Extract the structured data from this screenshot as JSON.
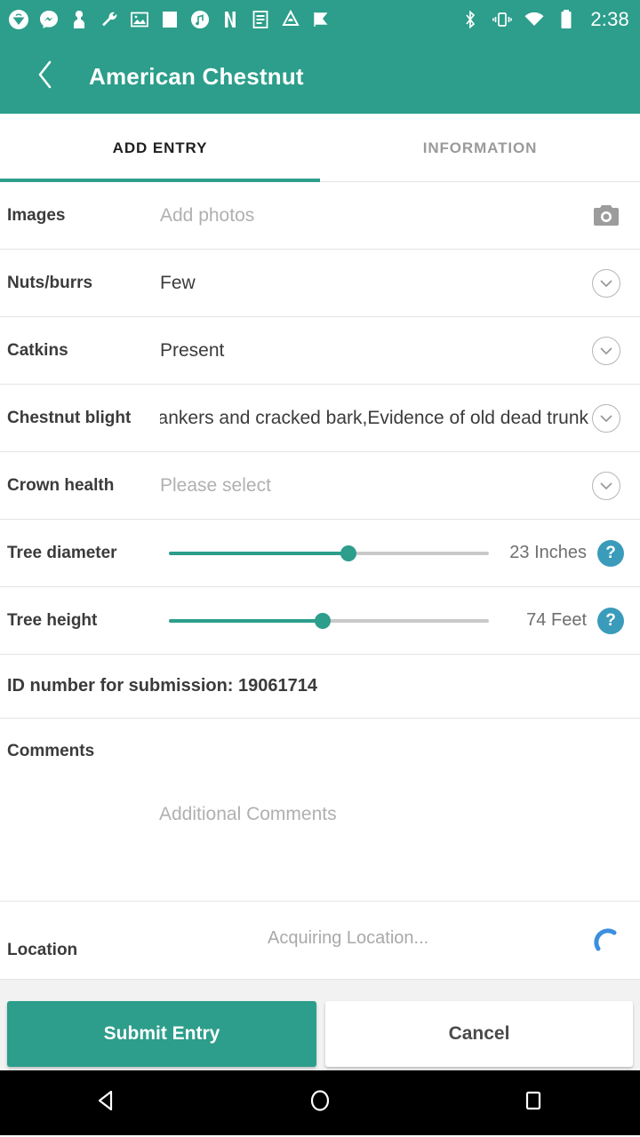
{
  "status_bar": {
    "time": "2:38",
    "left_icons": [
      {
        "name": "app-notification-icon"
      },
      {
        "name": "messenger-icon"
      },
      {
        "name": "contact-icon"
      },
      {
        "name": "wrench-icon"
      },
      {
        "name": "photo-icon"
      },
      {
        "name": "square-icon"
      },
      {
        "name": "music-note-icon"
      },
      {
        "name": "netflix-icon"
      },
      {
        "name": "document-icon"
      },
      {
        "name": "drive-icon"
      },
      {
        "name": "checkmark-flag-icon"
      }
    ],
    "right_icons": [
      {
        "name": "bluetooth-icon"
      },
      {
        "name": "vibrate-icon"
      },
      {
        "name": "wifi-icon"
      },
      {
        "name": "battery-icon"
      }
    ]
  },
  "app_bar": {
    "back_icon": "chevron-left-icon",
    "title": "American Chestnut"
  },
  "tabs": {
    "items": [
      {
        "label": "ADD ENTRY",
        "active": true
      },
      {
        "label": "INFORMATION",
        "active": false
      }
    ]
  },
  "form": {
    "images": {
      "label": "Images",
      "placeholder": "Add photos",
      "action_icon": "camera-icon"
    },
    "nuts_burrs": {
      "label": "Nuts/burrs",
      "value": "Few",
      "action_icon": "chevron-down-circle-icon"
    },
    "catkins": {
      "label": "Catkins",
      "value": "Present",
      "action_icon": "chevron-down-circle-icon"
    },
    "chestnut_blight": {
      "label": "Chestnut blight",
      "value": "Cankers and cracked bark,Evidence of old dead trunk",
      "action_icon": "chevron-down-circle-icon"
    },
    "crown_health": {
      "label": "Crown health",
      "placeholder": "Please select",
      "action_icon": "chevron-down-circle-icon"
    },
    "tree_diameter": {
      "label": "Tree diameter",
      "value_text": "23 Inches",
      "value": 23,
      "unit": "Inches",
      "fill_percent": 56,
      "help_icon": "question-mark-icon"
    },
    "tree_height": {
      "label": "Tree height",
      "value_text": "74 Feet",
      "value": 74,
      "unit": "Feet",
      "fill_percent": 48,
      "help_icon": "question-mark-icon"
    },
    "submission_id": {
      "text": "ID number for submission: 19061714",
      "number": "19061714"
    },
    "comments": {
      "label": "Comments",
      "placeholder": "Additional Comments",
      "value": ""
    },
    "location": {
      "label": "Location",
      "status": "Acquiring Location...",
      "spinner_icon": "loading-spinner-icon"
    }
  },
  "footer": {
    "submit_label": "Submit Entry",
    "cancel_label": "Cancel"
  },
  "nav_bar": {
    "back": "back-triangle-icon",
    "home": "home-circle-icon",
    "recents": "recents-square-icon"
  },
  "colors": {
    "accent_teal": "#2c9e8b",
    "help_blue": "#3a9cba",
    "spinner_blue": "#3c8ee0",
    "divider": "#e4e4e4",
    "placeholder": "#b0b0b0"
  }
}
